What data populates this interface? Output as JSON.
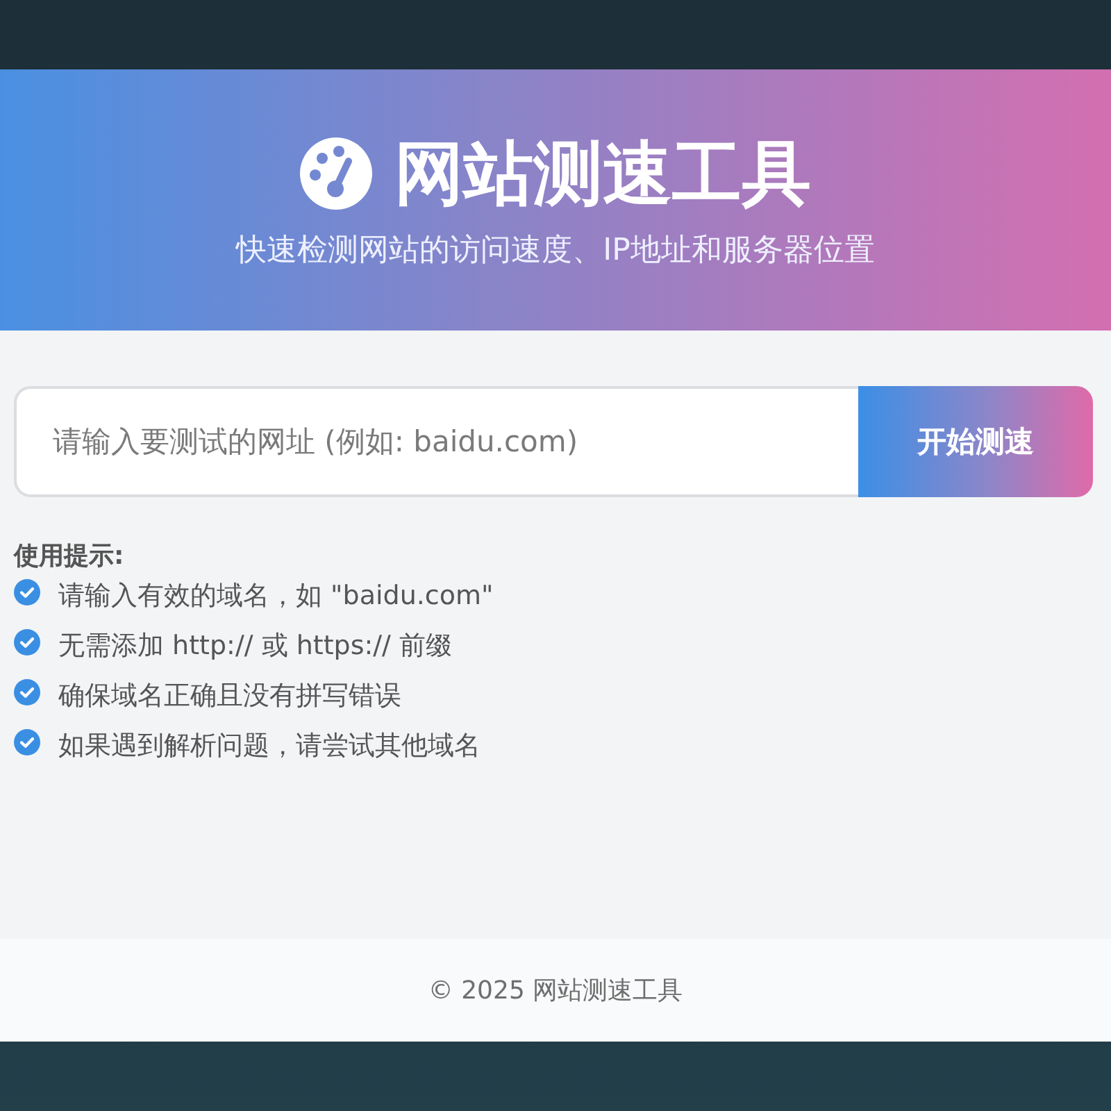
{
  "header": {
    "title": "网站测速工具",
    "subtitle": "快速检测网站的访问速度、IP地址和服务器位置"
  },
  "search": {
    "placeholder": "请输入要测试的网址 (例如: baidu.com)",
    "button": "开始测速"
  },
  "tips": {
    "heading": "使用提示:",
    "items": [
      "请输入有效的域名，如 \"baidu.com\"",
      "无需添加 http:// 或 https:// 前缀",
      "确保域名正确且没有拼写错误",
      "如果遇到解析问题，请尝试其他域名"
    ]
  },
  "footer": {
    "text": "© 2025 网站测速工具"
  }
}
